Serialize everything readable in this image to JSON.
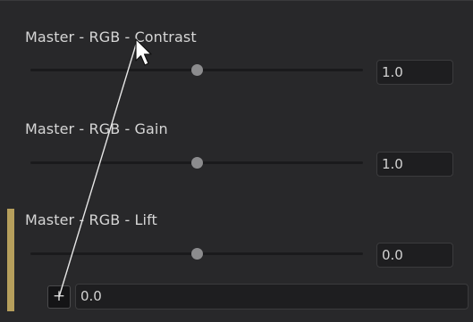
{
  "params": [
    {
      "label": "Master - RGB - Contrast",
      "value": "1.0",
      "slider_fraction": 0.5
    },
    {
      "label": "Master - RGB - Gain",
      "value": "1.0",
      "slider_fraction": 0.5
    },
    {
      "label": "Master - RGB - Lift",
      "value": "0.0",
      "slider_fraction": 0.5
    }
  ],
  "expression": {
    "button_label": "+",
    "value": "0.0"
  },
  "colors": {
    "panel_bg": "#28282a",
    "accent": "#b69f5c",
    "text": "#d6d6d6"
  },
  "icons": {
    "cursor": "mouse-pointer-icon",
    "link_line": "pick-whip-line"
  }
}
